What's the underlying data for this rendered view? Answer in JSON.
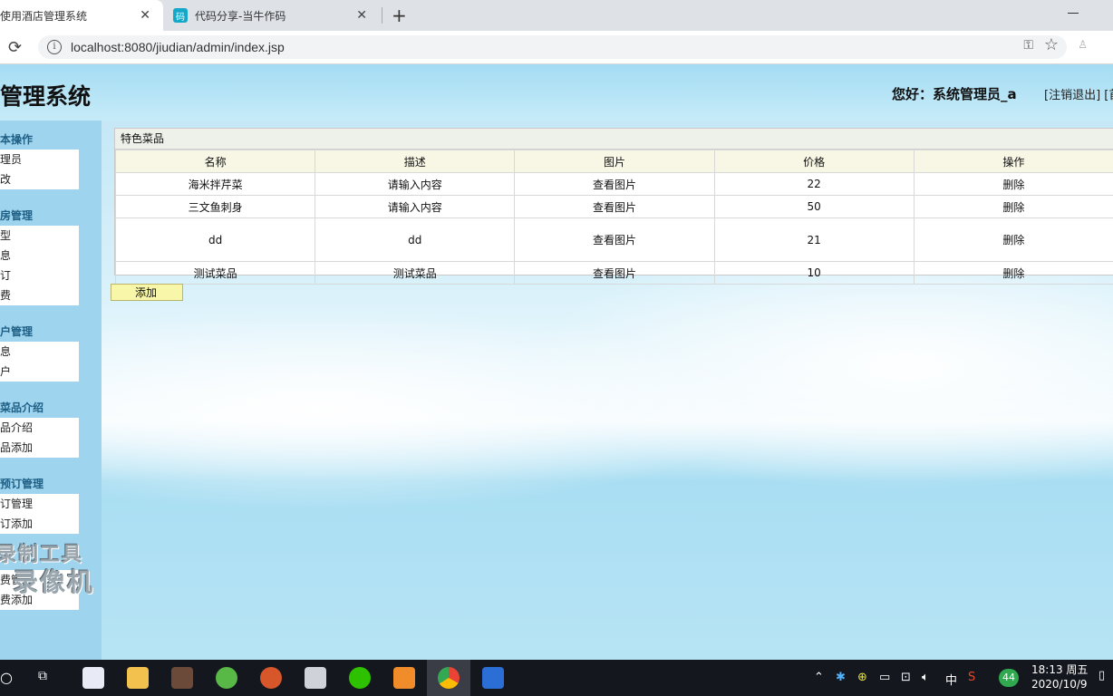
{
  "browser": {
    "tabs": [
      {
        "title": "使用酒店管理系统"
      },
      {
        "title": "代码分享-当牛作码",
        "favicon_text": "码"
      }
    ],
    "url": "localhost:8080/jiudian/admin/index.jsp"
  },
  "header": {
    "title": "管理系统",
    "greeting": "您好：系统管理员_a",
    "logout": "[注销退出] [首"
  },
  "sidebar": {
    "sections": [
      {
        "title": "本操作",
        "items": [
          "理员",
          "改"
        ]
      },
      {
        "title": "房管理",
        "items": [
          "型",
          "息",
          "订",
          "费"
        ]
      },
      {
        "title": "户管理",
        "items": [
          "息",
          "户"
        ]
      },
      {
        "title": "菜品介绍",
        "items": [
          "品介绍",
          "品添加"
        ]
      },
      {
        "title": "预订管理",
        "items": [
          "订管理",
          "订添加"
        ]
      },
      {
        "title": "",
        "items": [
          "费管理",
          "费添加"
        ]
      }
    ]
  },
  "panel": {
    "title": "特色菜品",
    "columns": [
      "名称",
      "描述",
      "图片",
      "价格",
      "操作"
    ],
    "rows": [
      {
        "name": "海米拌芹菜",
        "desc": "请输入内容",
        "image": "查看图片",
        "price": "22",
        "action": "删除"
      },
      {
        "name": "三文鱼刺身",
        "desc": "请输入内容",
        "image": "查看图片",
        "price": "50",
        "action": "删除"
      },
      {
        "name": "dd",
        "desc": "dd",
        "image": "查看图片",
        "price": "21",
        "action": "删除"
      },
      {
        "name": "测试菜品",
        "desc": "测试菜品",
        "image": "查看图片",
        "price": "10",
        "action": "删除"
      }
    ],
    "add_label": "添加"
  },
  "watermark": {
    "line1": "录制工具",
    "line2": "录像机"
  },
  "taskbar": {
    "tray_ime": "中",
    "tray_badge": "44",
    "time": "18:13 周五",
    "date": "2020/10/9"
  },
  "colors": {
    "sidebar": "#9fd4ee",
    "header_bg": "#a4dcf3",
    "add_button": "#f8f6a8",
    "taskbar": "#15171e"
  }
}
